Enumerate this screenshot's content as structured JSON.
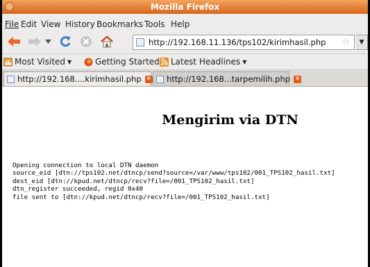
{
  "window": {
    "title": "Mozilla Firefox"
  },
  "menu": [
    "File",
    "Edit",
    "View",
    "History",
    "Bookmarks",
    "Tools",
    "Help"
  ],
  "navigation": {
    "url": "http://192.168.11.136/tps102/kirimhasil.php",
    "icons": [
      "back-arrow-icon",
      "forward-arrow-icon",
      "dropdown-arrow-icon",
      "reload-icon",
      "stop-icon",
      "home-icon"
    ]
  },
  "bookmarks": [
    {
      "label": "Most Visited",
      "icon": "most-visited-icon",
      "dropdown": true
    },
    {
      "label": "Getting Started",
      "icon": "firefox-icon",
      "dropdown": false
    },
    {
      "label": "Latest Headlines",
      "icon": "rss-icon",
      "dropdown": true
    }
  ],
  "tabs": [
    {
      "label": "http://192.168....kirimhasil.php",
      "active": true
    },
    {
      "label": "http://192.168...tarpemilih.php",
      "active": false
    }
  ],
  "page": {
    "heading": "Mengirim via DTN",
    "output_lines": [
      "Opening connection to local DTN daemon",
      "source_eid [dtn://tps102.net/dtncp/send?source=/var/www/tps102/001_TPS102_hasil.txt]",
      "dest_eid [dtn://kpud.net/dtncp/recv?file=/001_TPS102_hasil.txt]",
      "dtn_register succeeded, regid 0x40",
      "file sent to [dtn://kpud.net/dtncp/recv?file=/001_TPS102_hasil.txt]"
    ]
  },
  "colors": {
    "titlebar": "#e17a30",
    "close_tab": "#e05a1c",
    "nav_arrow": "#e8692c",
    "reload": "#3d7fc2"
  }
}
